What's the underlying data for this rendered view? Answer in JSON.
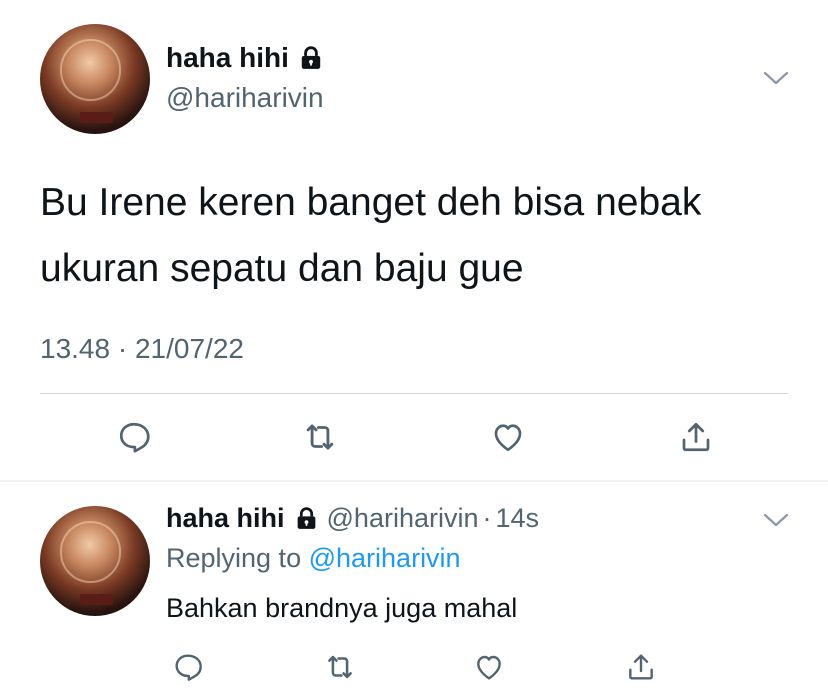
{
  "main_tweet": {
    "author_name": "haha hihi",
    "author_handle": "@hariharivin",
    "text_line1": "Bu Irene keren banget deh bisa nebak",
    "text_line2": "ukuran sepatu dan baju gue",
    "time": "13.48",
    "separator": "·",
    "date": "21/07/22",
    "icons": {
      "protected": "lock-icon",
      "menu": "chevron-down-icon",
      "reply": "reply-icon",
      "retweet": "retweet-icon",
      "like": "like-icon",
      "share": "share-icon"
    }
  },
  "reply_tweet": {
    "author_name": "haha hihi",
    "author_handle": "@hariharivin",
    "separator": "·",
    "age": "14s",
    "replying_prefix": "Replying to",
    "replying_to": "@hariharivin",
    "text": "Bahkan brandnya juga mahal"
  },
  "colors": {
    "text_primary": "#0f1419",
    "text_secondary": "#536471",
    "link": "#1d9bf0",
    "divider": "#cfd9de"
  }
}
